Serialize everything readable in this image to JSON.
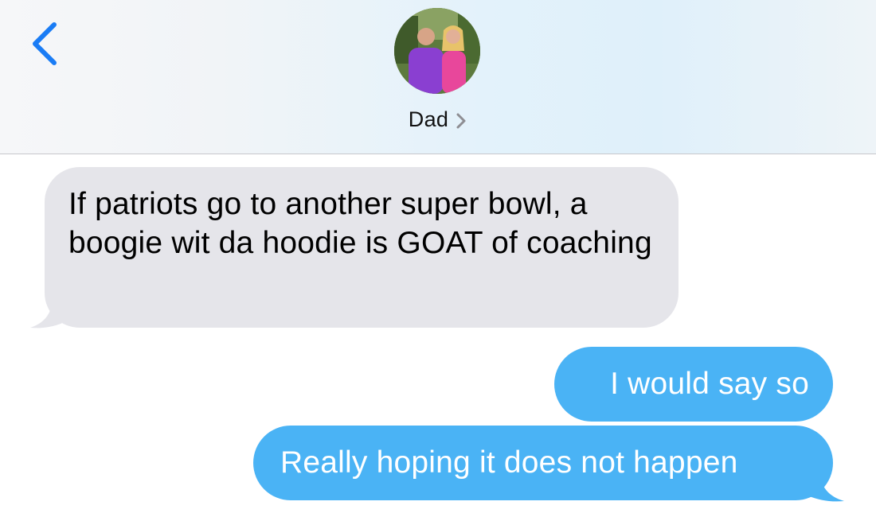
{
  "colors": {
    "accent": "#1a7cf5",
    "incoming_bubble": "#e5e5ea",
    "outgoing_bubble": "#4ab3f5"
  },
  "header": {
    "back_icon": "chevron-left-icon",
    "contact_name": "Dad",
    "contact_chevron_icon": "chevron-right-icon",
    "avatar": "contact-photo"
  },
  "messages": [
    {
      "direction": "incoming",
      "text": "If patriots go to another super bowl, a boogie wit da hoodie is GOAT of coaching"
    },
    {
      "direction": "outgoing",
      "text": "I would say so"
    },
    {
      "direction": "outgoing",
      "text": "Really hoping it does not happen"
    }
  ]
}
